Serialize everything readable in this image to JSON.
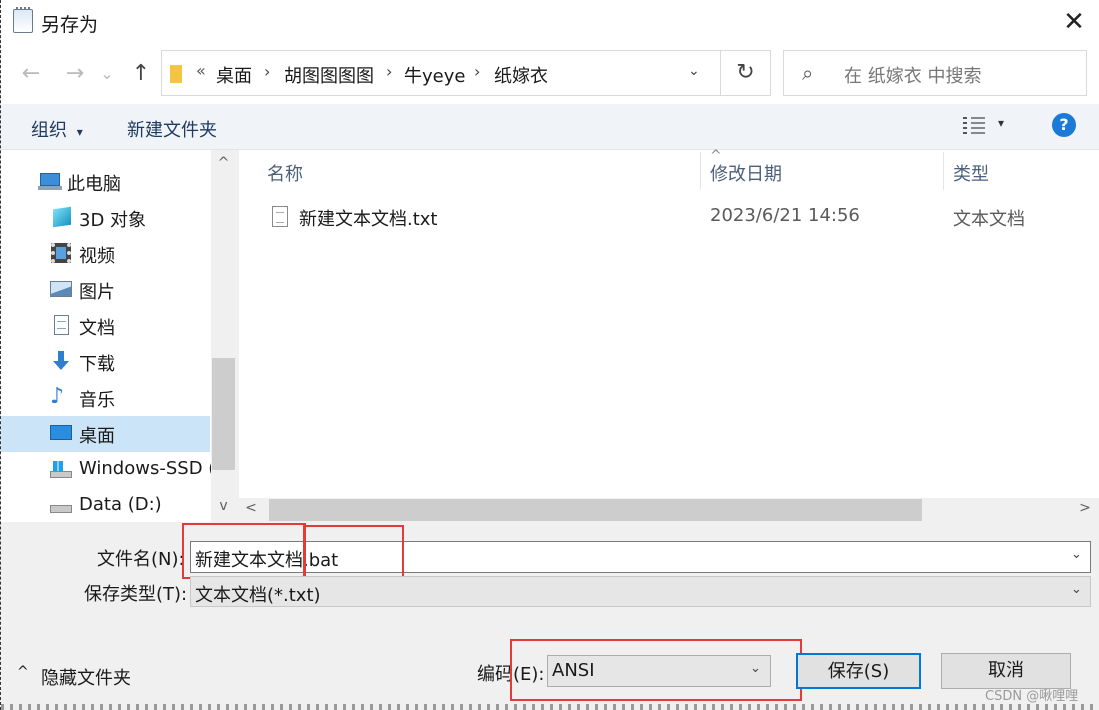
{
  "window": {
    "title": "另存为",
    "close_glyph": "✕"
  },
  "nav": {
    "back_glyph": "←",
    "forward_glyph": "→",
    "recent_glyph": "⌄",
    "up_glyph": "↑",
    "refresh_glyph": "↻",
    "overflow_glyph": "«",
    "separator_glyph": "›",
    "breadcrumbs": [
      "桌面",
      "胡图图图图",
      "牛yeye",
      "纸嫁衣"
    ],
    "search_placeholder": "在 纸嫁衣 中搜索"
  },
  "toolbar": {
    "organize_label": "组织",
    "organize_caret": "▾",
    "new_folder_label": "新建文件夹",
    "view_caret": "▾",
    "help_glyph": "?"
  },
  "sidebar": {
    "items": [
      {
        "label": "此电脑",
        "icon": "computer-icon"
      },
      {
        "label": "3D 对象",
        "icon": "cube-3d-icon"
      },
      {
        "label": "视频",
        "icon": "video-icon"
      },
      {
        "label": "图片",
        "icon": "picture-icon"
      },
      {
        "label": "文档",
        "icon": "document-icon"
      },
      {
        "label": "下载",
        "icon": "download-icon"
      },
      {
        "label": "音乐",
        "icon": "music-icon"
      },
      {
        "label": "桌面",
        "icon": "desktop-icon",
        "selected": true
      },
      {
        "label": "Windows-SSD (",
        "icon": "drive-icon"
      },
      {
        "label": "Data (D:)",
        "icon": "drive-icon"
      }
    ]
  },
  "files": {
    "columns": [
      "名称",
      "修改日期",
      "类型"
    ],
    "rows": [
      {
        "name": "新建文本文档.txt",
        "modified": "2023/6/21 14:56",
        "type": "文本文档"
      }
    ]
  },
  "scroll": {
    "up_glyph": "^",
    "down_glyph": "v",
    "left_glyph": "<",
    "right_glyph": ">",
    "sort_glyph": "^"
  },
  "form": {
    "filename_label": "文件名(N):",
    "filename_value": "新建文本文档.bat",
    "filetype_label": "保存类型(T):",
    "filetype_value": "文本文档(*.txt)",
    "encoding_label": "编码(E):",
    "encoding_value": "ANSI",
    "dropdown_caret": "⌄",
    "hide_folders_label": "隐藏文件夹",
    "hide_folders_glyph": "^",
    "save_label": "保存(S)",
    "cancel_label": "取消"
  },
  "watermark": "CSDN @啾哩哩",
  "colors": {
    "accent": "#0078d7",
    "selection": "#cce4f7",
    "highlight_box": "#e5393b",
    "help": "#1c7ad7"
  }
}
